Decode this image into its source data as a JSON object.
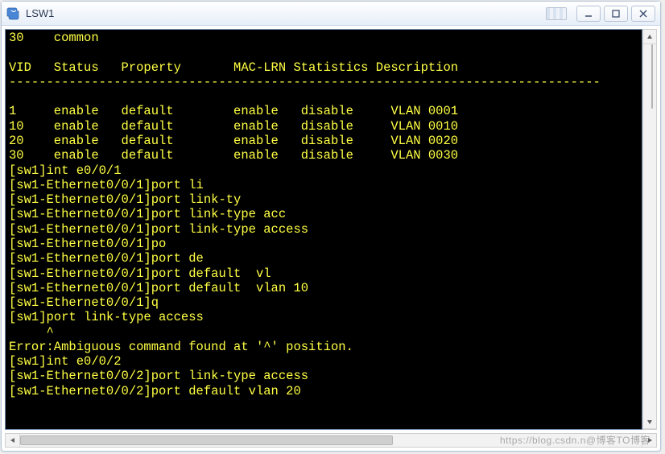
{
  "window": {
    "title": "LSW1"
  },
  "terminal": {
    "lines": [
      "30    common",
      "",
      "VID   Status   Property       MAC-LRN Statistics Description",
      "-------------------------------------------------------------------------------",
      "",
      "1     enable   default        enable   disable     VLAN 0001",
      "10    enable   default        enable   disable     VLAN 0010",
      "20    enable   default        enable   disable     VLAN 0020",
      "30    enable   default        enable   disable     VLAN 0030",
      "[sw1]int e0/0/1",
      "[sw1-Ethernet0/0/1]port li",
      "[sw1-Ethernet0/0/1]port link-ty",
      "[sw1-Ethernet0/0/1]port link-type acc",
      "[sw1-Ethernet0/0/1]port link-type access",
      "[sw1-Ethernet0/0/1]po",
      "[sw1-Ethernet0/0/1]port de",
      "[sw1-Ethernet0/0/1]port default  vl",
      "[sw1-Ethernet0/0/1]port default  vlan 10",
      "[sw1-Ethernet0/0/1]q",
      "[sw1]port link-type access",
      "     ^",
      "Error:Ambiguous command found at '^' position.",
      "[sw1]int e0/0/2",
      "[sw1-Ethernet0/0/2]port link-type access",
      "[sw1-Ethernet0/0/2]port default vlan 20"
    ]
  },
  "watermark": "https://blog.csdn.n@博客TO博客",
  "colors": {
    "termBg": "#000000",
    "termFg": "#ffff44",
    "titlebar": "#eef3fa",
    "border": "#b5c7de"
  }
}
